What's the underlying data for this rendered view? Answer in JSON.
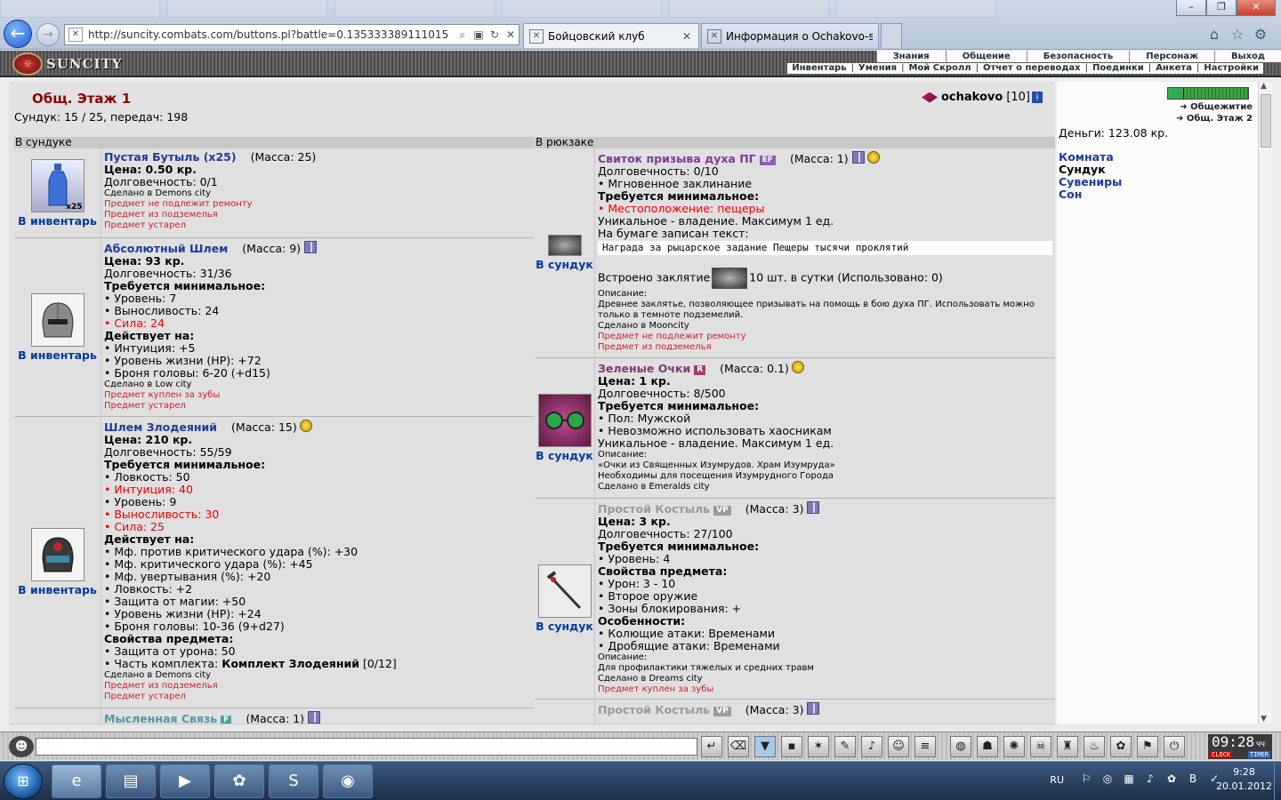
{
  "browser": {
    "url": "http://suncity.combats.com/buttons.pl?battle=0.135333389111015",
    "tabs": [
      {
        "label": "Бойцовский клуб",
        "active": true
      },
      {
        "label": "Информация о Ochakovo-sm...",
        "active": false
      }
    ]
  },
  "game": {
    "logo": "SUNCITY",
    "menu": [
      "Знания",
      "Общение",
      "Безопасность",
      "Персонаж",
      "Выход"
    ],
    "submenu": [
      "Инвентарь",
      "Умения",
      "Мой Скролл",
      "Отчет о переводах",
      "Поединки",
      "Анкета",
      "Настройки"
    ]
  },
  "room": {
    "title": "Общ. Этаж 1",
    "user": "ochakovo",
    "level": "[10]",
    "chest_info": "Сундук: 15 / 25, передач: 198",
    "col_left": "В сундуке",
    "col_right": "В рюкзаке"
  },
  "left_items": [
    {
      "name": "Пустая Бутыль (x25)",
      "mass": "(Масса: 25)",
      "badge": "x25",
      "action": "В инвентарь",
      "price": "Цена: 0.50 кр.",
      "durability": "Долговечность: 0/1",
      "made": "Сделано в Demons city",
      "notes": [
        "Предмет не подлежит ремонту",
        "Предмет из подземелья",
        "Предмет устарел"
      ]
    },
    {
      "name": "Абсолютный Шлем",
      "mass": "(Масса: 9)",
      "action": "В инвентарь",
      "price": "Цена: 93 кр.",
      "durability": "Долговечность: 31/36",
      "req_title": "Требуется минимальное:",
      "req": [
        "• Уровень: 7",
        "• Выносливость: 24"
      ],
      "req_red": "• Сила: 24",
      "act_title": "Действует на:",
      "acts": [
        "• Интуиция: +5",
        "• Уровень жизни (HP): +72",
        "• Броня головы: 6-20 (+d15)"
      ],
      "made": "Сделано в Low city",
      "notes": [
        "Предмет куплен за зубы",
        "Предмет устарел"
      ]
    },
    {
      "name": "Шлем Злодеяний",
      "mass": "(Масса: 15)",
      "action": "В инвентарь",
      "price": "Цена: 210 кр.",
      "durability": "Долговечность: 55/59",
      "req_title": "Требуется минимальное:",
      "req_line1": "• Ловкость: 50",
      "req_red1": "• Интуиция: 40",
      "req_line2": "• Уровень: 9",
      "req_red2": "• Выносливость: 30",
      "req_red3": "• Сила: 25",
      "act_title": "Действует на:",
      "acts": [
        "• Мф. против критического удара (%): +30",
        "• Мф. критического удара (%): +45",
        "• Мф. увертывания (%): +20",
        "• Ловкость: +2",
        "• Защита от магии: +50",
        "• Уровень жизни (HP): +24",
        "• Броня головы: 10-36 (9+d27)"
      ],
      "props_title": "Свойства предмета:",
      "props": [
        "• Защита от урона: 50"
      ],
      "set_label": "• Часть комплекта: ",
      "set_name": "Комплект Злодеяний",
      "set_count": " [0/12]",
      "made": "Сделано в Demons city",
      "notes": [
        "Предмет из подземелья",
        "Предмет устарел"
      ]
    },
    {
      "name": "Мысленная Связь",
      "tag": "F",
      "mass": "(Масса: 1)"
    }
  ],
  "right_items": [
    {
      "name": "Свиток призыва духа ПГ",
      "tag": "EF",
      "mass": "(Масса: 1)",
      "action": "В сундук",
      "durability": "Долговечность: 0/10",
      "line1": "• Мгновенное заклинание",
      "req_title": "Требуется минимальное:",
      "req_red": "• Местоположение: пещеры",
      "unique": "Уникальное - владение. Максимум 1 ед.",
      "paper": "На бумаге записан текст:",
      "paper_text": "Награда за рыцарское задание Пещеры тысячи проклятий",
      "spell_pre": "Встроено заклятие",
      "spell_post": "10 шт. в сутки (Использовано: 0)",
      "desc_title": "Описание:",
      "desc": "Древнее заклятье, позволяющее призывать на помощь в бою духа ПГ. Использовать можно только в темноте подземелий.",
      "made": "Сделано в Mooncity",
      "notes": [
        "Предмет не подлежит ремонту",
        "Предмет из подземелья"
      ]
    },
    {
      "name": "Зеленые Очки",
      "tag": "R",
      "mass": "(Масса: 0.1)",
      "action": "В сундук",
      "price": "Цена: 1 кр.",
      "durability": "Долговечность: 8/500",
      "req_title": "Требуется минимальное:",
      "req": [
        "• Пол: Мужской",
        "• Невозможно использовать хаосникам"
      ],
      "unique": "Уникальное - владение. Максимум 1 ед.",
      "desc_title": "Описание:",
      "desc_lines": [
        "«Очки из Священных Изумрудов. Храм Изумруда»",
        "Необходимы для посещения Изумрудного Города"
      ],
      "made": "Сделано в Emeralds city"
    },
    {
      "name": "Простой Костыль",
      "tag": "VP",
      "mass": "(Масса: 3)",
      "action": "В сундук",
      "price": "Цена: 3 кр.",
      "durability": "Долговечность: 27/100",
      "req_title": "Требуется минимальное:",
      "req": [
        "• Уровень: 4"
      ],
      "props_title": "Свойства предмета:",
      "props": [
        "• Урон: 3 - 10",
        "• Второе оружие",
        "• Зоны блокирования: +"
      ],
      "feat_title": "Особенности:",
      "feats": [
        "• Колющие атаки: Временами",
        "• Дробящие атаки: Временами"
      ],
      "desc_title": "Описание:",
      "desc": "Для профилактики тяжелых и средних травм",
      "made": "Сделано в Dreams city",
      "notes": [
        "Предмет куплен за зубы"
      ]
    },
    {
      "name": "Простой Костыль",
      "tag": "VP",
      "mass": "(Масса: 3)"
    }
  ],
  "side": {
    "loc1": "Общежитие",
    "loc2": "Общ. Этаж 2",
    "money": "Деньги: 123.08 кр.",
    "links": [
      "Комната",
      "Сундук",
      "Сувениры",
      "Сон"
    ]
  },
  "clock": {
    "time": "09:28",
    "unit": "ЧЧ",
    "label1": "CLOCK",
    "label2": "TIMER"
  },
  "taskbar": {
    "lang": "RU",
    "time": "9:28",
    "date": "20.01.2012"
  },
  "colors": {
    "title_red": "#8b0000",
    "link_blue": "#1e3c99",
    "warning_red": "#c8242a"
  }
}
